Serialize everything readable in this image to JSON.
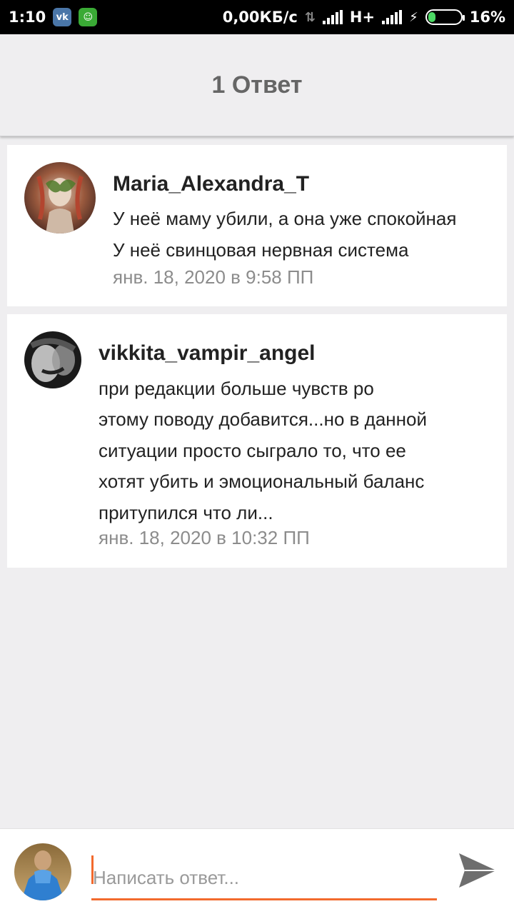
{
  "status_bar": {
    "time": "1:10",
    "vk_icon": "vk-icon",
    "bot_icon": "android-bot-icon",
    "network_speed": "0,00КБ/с",
    "network_type": "H+",
    "battery_percent": "16%"
  },
  "header": {
    "title": "1 Ответ"
  },
  "comments": [
    {
      "author": "Maria_Alexandra_T",
      "lines": [
        "У неё маму убили, а она уже спокойная",
        "У неё свинцовая нервная система"
      ],
      "date": "янв. 18, 2020 в 9:58 ПП"
    },
    {
      "author": "vikkita_vampir_angel",
      "lines": [
        "при редакции больше  чувств ро",
        "этому поводу добавится...но в данной",
        "ситуации просто сыграло то, что ее",
        "хотят убить и эмоциональный баланс",
        "притупился что ли..."
      ],
      "date": "янв. 18, 2020 в 10:32 ПП"
    }
  ],
  "reply": {
    "placeholder": "Написать ответ...",
    "value": ""
  },
  "colors": {
    "accent": "#f26a2e",
    "background": "#efeef0"
  }
}
